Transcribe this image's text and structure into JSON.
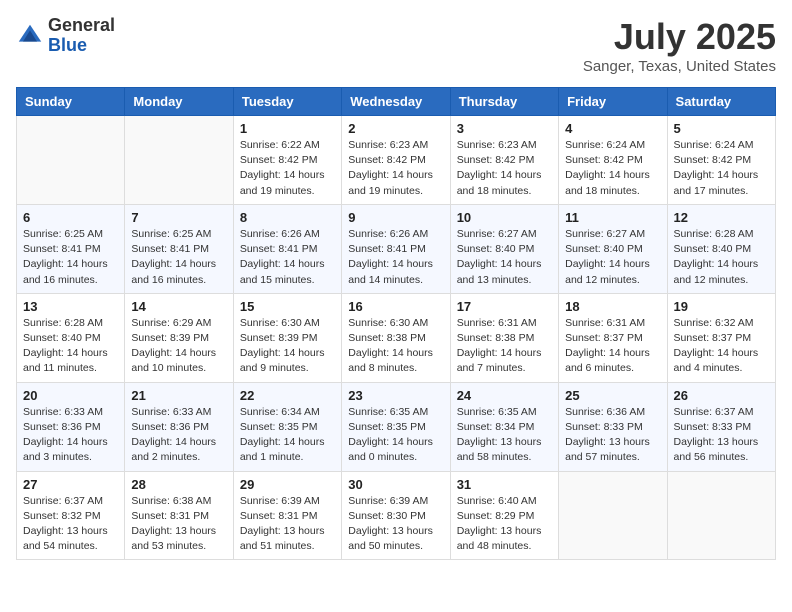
{
  "header": {
    "logo_general": "General",
    "logo_blue": "Blue",
    "month_title": "July 2025",
    "location": "Sanger, Texas, United States"
  },
  "weekdays": [
    "Sunday",
    "Monday",
    "Tuesday",
    "Wednesday",
    "Thursday",
    "Friday",
    "Saturday"
  ],
  "weeks": [
    [
      {
        "day": "",
        "info": ""
      },
      {
        "day": "",
        "info": ""
      },
      {
        "day": "1",
        "info": "Sunrise: 6:22 AM\nSunset: 8:42 PM\nDaylight: 14 hours and 19 minutes."
      },
      {
        "day": "2",
        "info": "Sunrise: 6:23 AM\nSunset: 8:42 PM\nDaylight: 14 hours and 19 minutes."
      },
      {
        "day": "3",
        "info": "Sunrise: 6:23 AM\nSunset: 8:42 PM\nDaylight: 14 hours and 18 minutes."
      },
      {
        "day": "4",
        "info": "Sunrise: 6:24 AM\nSunset: 8:42 PM\nDaylight: 14 hours and 18 minutes."
      },
      {
        "day": "5",
        "info": "Sunrise: 6:24 AM\nSunset: 8:42 PM\nDaylight: 14 hours and 17 minutes."
      }
    ],
    [
      {
        "day": "6",
        "info": "Sunrise: 6:25 AM\nSunset: 8:41 PM\nDaylight: 14 hours and 16 minutes."
      },
      {
        "day": "7",
        "info": "Sunrise: 6:25 AM\nSunset: 8:41 PM\nDaylight: 14 hours and 16 minutes."
      },
      {
        "day": "8",
        "info": "Sunrise: 6:26 AM\nSunset: 8:41 PM\nDaylight: 14 hours and 15 minutes."
      },
      {
        "day": "9",
        "info": "Sunrise: 6:26 AM\nSunset: 8:41 PM\nDaylight: 14 hours and 14 minutes."
      },
      {
        "day": "10",
        "info": "Sunrise: 6:27 AM\nSunset: 8:40 PM\nDaylight: 14 hours and 13 minutes."
      },
      {
        "day": "11",
        "info": "Sunrise: 6:27 AM\nSunset: 8:40 PM\nDaylight: 14 hours and 12 minutes."
      },
      {
        "day": "12",
        "info": "Sunrise: 6:28 AM\nSunset: 8:40 PM\nDaylight: 14 hours and 12 minutes."
      }
    ],
    [
      {
        "day": "13",
        "info": "Sunrise: 6:28 AM\nSunset: 8:40 PM\nDaylight: 14 hours and 11 minutes."
      },
      {
        "day": "14",
        "info": "Sunrise: 6:29 AM\nSunset: 8:39 PM\nDaylight: 14 hours and 10 minutes."
      },
      {
        "day": "15",
        "info": "Sunrise: 6:30 AM\nSunset: 8:39 PM\nDaylight: 14 hours and 9 minutes."
      },
      {
        "day": "16",
        "info": "Sunrise: 6:30 AM\nSunset: 8:38 PM\nDaylight: 14 hours and 8 minutes."
      },
      {
        "day": "17",
        "info": "Sunrise: 6:31 AM\nSunset: 8:38 PM\nDaylight: 14 hours and 7 minutes."
      },
      {
        "day": "18",
        "info": "Sunrise: 6:31 AM\nSunset: 8:37 PM\nDaylight: 14 hours and 6 minutes."
      },
      {
        "day": "19",
        "info": "Sunrise: 6:32 AM\nSunset: 8:37 PM\nDaylight: 14 hours and 4 minutes."
      }
    ],
    [
      {
        "day": "20",
        "info": "Sunrise: 6:33 AM\nSunset: 8:36 PM\nDaylight: 14 hours and 3 minutes."
      },
      {
        "day": "21",
        "info": "Sunrise: 6:33 AM\nSunset: 8:36 PM\nDaylight: 14 hours and 2 minutes."
      },
      {
        "day": "22",
        "info": "Sunrise: 6:34 AM\nSunset: 8:35 PM\nDaylight: 14 hours and 1 minute."
      },
      {
        "day": "23",
        "info": "Sunrise: 6:35 AM\nSunset: 8:35 PM\nDaylight: 14 hours and 0 minutes."
      },
      {
        "day": "24",
        "info": "Sunrise: 6:35 AM\nSunset: 8:34 PM\nDaylight: 13 hours and 58 minutes."
      },
      {
        "day": "25",
        "info": "Sunrise: 6:36 AM\nSunset: 8:33 PM\nDaylight: 13 hours and 57 minutes."
      },
      {
        "day": "26",
        "info": "Sunrise: 6:37 AM\nSunset: 8:33 PM\nDaylight: 13 hours and 56 minutes."
      }
    ],
    [
      {
        "day": "27",
        "info": "Sunrise: 6:37 AM\nSunset: 8:32 PM\nDaylight: 13 hours and 54 minutes."
      },
      {
        "day": "28",
        "info": "Sunrise: 6:38 AM\nSunset: 8:31 PM\nDaylight: 13 hours and 53 minutes."
      },
      {
        "day": "29",
        "info": "Sunrise: 6:39 AM\nSunset: 8:31 PM\nDaylight: 13 hours and 51 minutes."
      },
      {
        "day": "30",
        "info": "Sunrise: 6:39 AM\nSunset: 8:30 PM\nDaylight: 13 hours and 50 minutes."
      },
      {
        "day": "31",
        "info": "Sunrise: 6:40 AM\nSunset: 8:29 PM\nDaylight: 13 hours and 48 minutes."
      },
      {
        "day": "",
        "info": ""
      },
      {
        "day": "",
        "info": ""
      }
    ]
  ]
}
